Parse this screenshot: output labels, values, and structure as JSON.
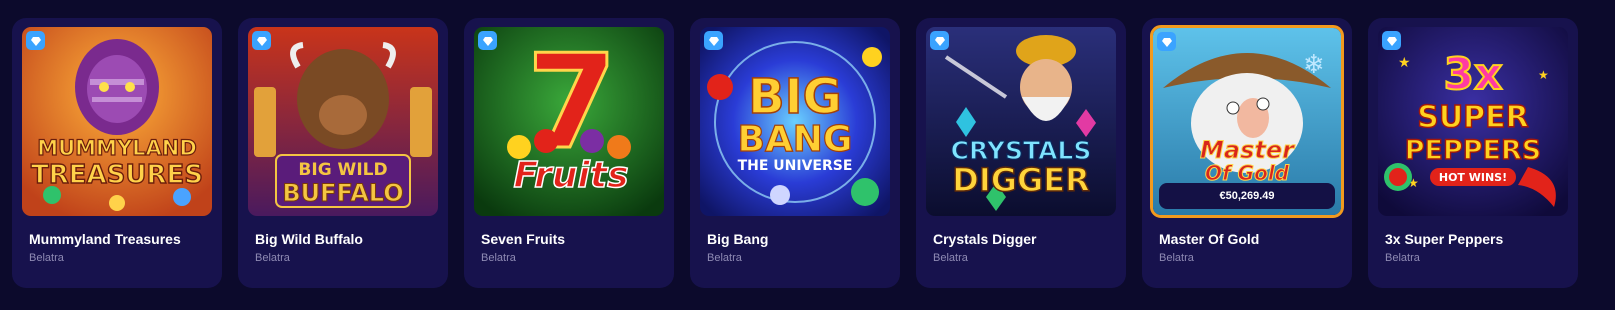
{
  "games": [
    {
      "id": "mummyland-treasures",
      "title": "Mummyland Treasures",
      "provider": "Belatra",
      "art_lines": [
        "MUMMYLAND",
        "TREASURES"
      ],
      "icon": "diamond-icon",
      "colors": {
        "bg": "#f08a1a",
        "bg2": "#7a2a8e",
        "text": "#ffd24a"
      }
    },
    {
      "id": "big-wild-buffalo",
      "title": "Big Wild Buffalo",
      "provider": "Belatra",
      "art_lines": [
        "BIG WILD",
        "BUFFALO"
      ],
      "icon": "diamond-icon",
      "colors": {
        "bg": "#b23b16",
        "bg2": "#3d1b5e",
        "text": "#f4c542"
      }
    },
    {
      "id": "seven-fruits",
      "title": "Seven Fruits",
      "provider": "Belatra",
      "art_lines": [
        "7",
        "Fruits"
      ],
      "icon": "diamond-icon",
      "colors": {
        "bg": "#1d7a1d",
        "bg2": "#0a3a0e",
        "text": "#e2231a"
      }
    },
    {
      "id": "big-bang",
      "title": "Big Bang",
      "provider": "Belatra",
      "art_lines": [
        "BIG",
        "BANG",
        "THE UNIVERSE"
      ],
      "icon": "diamond-icon",
      "colors": {
        "bg": "#2a3cd6",
        "bg2": "#0f1566",
        "text": "#ffcf33"
      }
    },
    {
      "id": "crystals-digger",
      "title": "Crystals Digger",
      "provider": "Belatra",
      "art_lines": [
        "CRYSTALS",
        "DIGGER"
      ],
      "icon": "diamond-icon",
      "colors": {
        "bg": "#1a1f5c",
        "bg2": "#0b0d2e",
        "text": "#ffd43b"
      }
    },
    {
      "id": "master-of-gold",
      "title": "Master Of Gold",
      "provider": "Belatra",
      "art_lines": [
        "Master",
        "Of Gold"
      ],
      "icon": "diamond-icon",
      "jackpot": "€50,269.49",
      "colors": {
        "bg": "#3fa9d9",
        "bg2": "#8a5a2b",
        "text": "#d8261c",
        "border": "#f29a1e"
      }
    },
    {
      "id": "3x-super-peppers",
      "title": "3x Super Peppers",
      "provider": "Belatra",
      "art_lines": [
        "3x",
        "SUPER",
        "PEPPERS",
        "HOT WINS!"
      ],
      "icon": "diamond-icon",
      "colors": {
        "bg": "#2a1f7a",
        "bg2": "#0f0a3a",
        "text": "#ffd21f"
      }
    }
  ]
}
